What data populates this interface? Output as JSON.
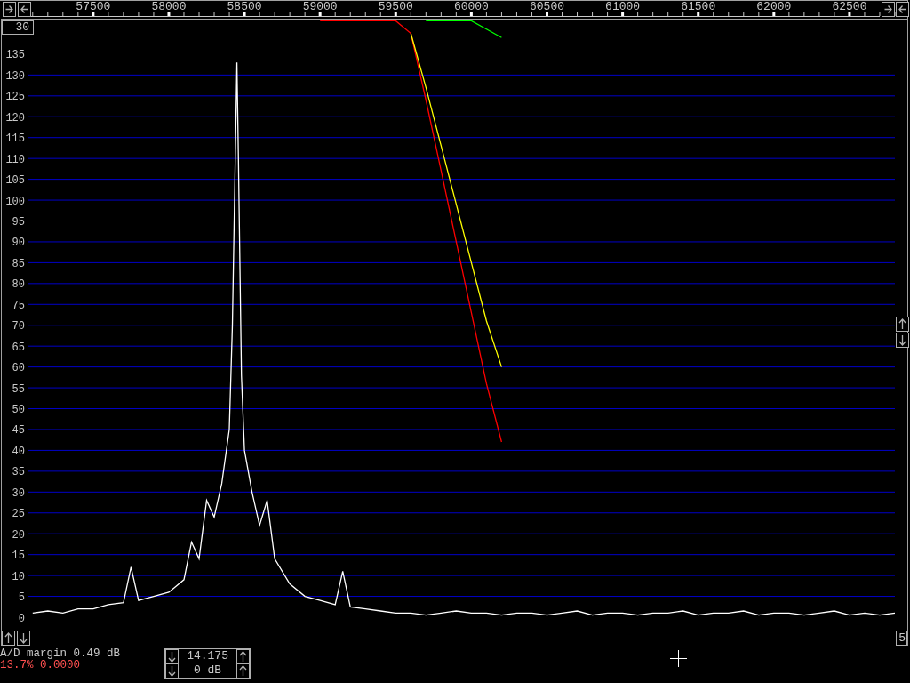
{
  "spectrum": {
    "scale_field": "30",
    "page_field": "5",
    "chart_data": {
      "type": "line",
      "xlim": [
        57072,
        62800
      ],
      "ylim": [
        0,
        143.3
      ],
      "grid": true,
      "xticks": [
        57500,
        58000,
        58500,
        59000,
        59500,
        60000,
        60500,
        61000,
        61500,
        62000,
        62500
      ],
      "yticks": [
        0,
        5,
        10,
        15,
        20,
        25,
        30,
        35,
        40,
        45,
        50,
        55,
        60,
        65,
        70,
        75,
        80,
        85,
        90,
        95,
        100,
        105,
        110,
        115,
        120,
        125,
        130,
        135
      ],
      "x": [
        57100,
        57200,
        57300,
        57400,
        57500,
        57600,
        57700,
        57750,
        57800,
        57900,
        58000,
        58100,
        58150,
        58200,
        58250,
        58300,
        58350,
        58400,
        58420,
        58440,
        58450,
        58460,
        58480,
        58500,
        58550,
        58600,
        58650,
        58700,
        58800,
        58900,
        59000,
        59100,
        59150,
        59200,
        59300,
        59400,
        59500,
        59600,
        59700,
        59800,
        59900,
        60000,
        60100,
        60200,
        60300,
        60400,
        60500,
        60600,
        60700,
        60800,
        60900,
        61000,
        61100,
        61200,
        61300,
        61400,
        61500,
        61600,
        61700,
        61800,
        61900,
        62000,
        62100,
        62200,
        62300,
        62400,
        62500,
        62600,
        62700,
        62800
      ],
      "series": [
        {
          "color": "#ffffff",
          "values": [
            1,
            1.5,
            1,
            2,
            2,
            3,
            3.5,
            12,
            4,
            5,
            6,
            9,
            18,
            14,
            28,
            24,
            32,
            45,
            70,
            112,
            133,
            110,
            58,
            40,
            30,
            22,
            28,
            14,
            8,
            5,
            4,
            3,
            11,
            2.5,
            2,
            1.5,
            1,
            1,
            0.5,
            1,
            1.5,
            1,
            1,
            0.5,
            1,
            1,
            0.5,
            1,
            1.5,
            0.5,
            1,
            1,
            0.5,
            1,
            1,
            1.5,
            0.5,
            1,
            1,
            1.5,
            0.5,
            1,
            1,
            0.5,
            1,
            1.5,
            0.5,
            1,
            0.5,
            1
          ]
        },
        {
          "color": "#ff0000",
          "values": [
            null,
            null,
            null,
            null,
            null,
            null,
            null,
            null,
            null,
            null,
            null,
            null,
            null,
            null,
            null,
            null,
            null,
            null,
            null,
            null,
            null,
            null,
            null,
            null,
            null,
            null,
            null,
            null,
            null,
            null,
            143,
            143,
            143,
            143,
            143,
            143,
            143,
            140,
            124,
            107,
            90,
            73,
            56,
            42,
            null,
            null,
            null,
            null,
            null,
            null,
            null,
            null,
            null,
            null,
            null,
            null,
            null,
            null,
            null,
            null,
            null,
            null,
            null,
            null,
            null,
            null,
            null,
            null,
            null,
            null
          ]
        },
        {
          "color": "#ffff00",
          "values": [
            null,
            null,
            null,
            null,
            null,
            null,
            null,
            null,
            null,
            null,
            null,
            null,
            null,
            null,
            null,
            null,
            null,
            null,
            null,
            null,
            null,
            null,
            null,
            null,
            null,
            null,
            null,
            null,
            null,
            null,
            null,
            null,
            null,
            null,
            null,
            null,
            null,
            140,
            127,
            113,
            99,
            85,
            71,
            60,
            null,
            null,
            null,
            null,
            null,
            null,
            null,
            null,
            null,
            null,
            null,
            null,
            null,
            null,
            null,
            null,
            null,
            null,
            null,
            null,
            null,
            null,
            null,
            null,
            null,
            null
          ]
        },
        {
          "color": "#00ff00",
          "values": [
            null,
            null,
            null,
            null,
            null,
            null,
            null,
            null,
            null,
            null,
            null,
            null,
            null,
            null,
            null,
            null,
            null,
            null,
            null,
            null,
            null,
            null,
            null,
            null,
            null,
            null,
            null,
            null,
            null,
            null,
            null,
            null,
            null,
            null,
            null,
            null,
            null,
            null,
            143,
            143,
            143,
            143,
            141,
            139,
            null,
            null,
            null,
            null,
            null,
            null,
            null,
            null,
            null,
            null,
            null,
            null,
            null,
            null,
            null,
            null,
            null,
            null,
            null,
            null,
            null,
            null,
            null,
            null,
            null,
            null
          ]
        }
      ]
    }
  },
  "status": {
    "margin_text": "A/D margin 0.49 dB",
    "level_text": "13.7% 0.0000"
  },
  "tuning": {
    "frequency": "14.175",
    "gain": "0 dB"
  }
}
